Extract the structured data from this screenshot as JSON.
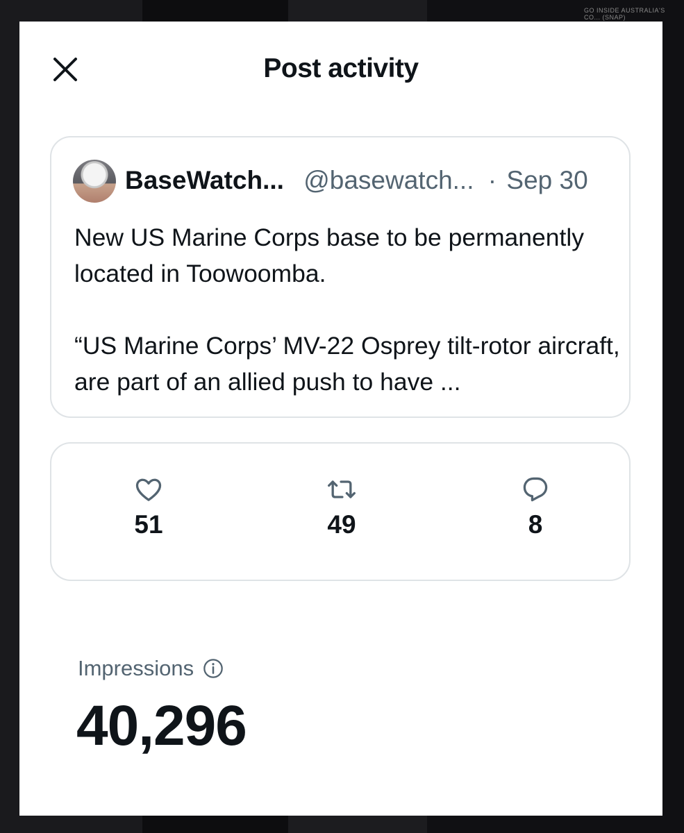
{
  "background": {
    "corner_text": "GO INSIDE AUSTRALIA'S CO... (SNAP)"
  },
  "modal": {
    "title": "Post activity",
    "close_icon": "close-icon"
  },
  "post": {
    "author_name": "BaseWatch...",
    "author_handle": "@basewatch...",
    "separator": "·",
    "date": "Sep 30",
    "paragraphs": [
      "New US Marine Corps base to be permanently located in Toowoomba.",
      "“US Marine Corps’ MV-22 Osprey tilt-rotor aircraft, are part of an allied push to have ..."
    ]
  },
  "stats": {
    "likes": {
      "icon": "heart-icon",
      "count": "51"
    },
    "reposts": {
      "icon": "repost-icon",
      "count": "49"
    },
    "replies": {
      "icon": "reply-icon",
      "count": "8"
    }
  },
  "impressions": {
    "label": "Impressions",
    "info_icon": "info-icon",
    "value": "40,296"
  },
  "colors": {
    "primary_text": "#0f1419",
    "secondary_text": "#536471",
    "border": "#dfe3e6",
    "icon": "#536471"
  }
}
